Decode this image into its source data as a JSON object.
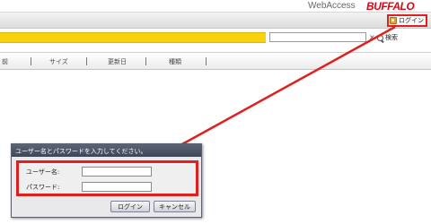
{
  "header": {
    "app_title": "WebAccess",
    "brand": "BUFFALO",
    "login_label": "ログイン"
  },
  "search": {
    "value": "",
    "placeholder": "",
    "clear_symbol": "×",
    "button_label": "検索"
  },
  "columns": [
    "前",
    "サイズ",
    "更新日",
    "種類"
  ],
  "dialog": {
    "title": "ユーザー名とパスワードを入力してください。",
    "username_label": "ユーザー名:",
    "password_label": "パスワード:",
    "username_value": "",
    "password_value": "",
    "login_button": "ログイン",
    "cancel_button": "キャンセル"
  },
  "colors": {
    "accent_yellow": "#f8d20e",
    "highlight_red": "#e02020",
    "brand_red": "#e60012",
    "dialog_title_bg": "#4a5264"
  },
  "icons": {
    "login": "user-key-icon",
    "clear": "close-icon",
    "search": "search-icon"
  }
}
